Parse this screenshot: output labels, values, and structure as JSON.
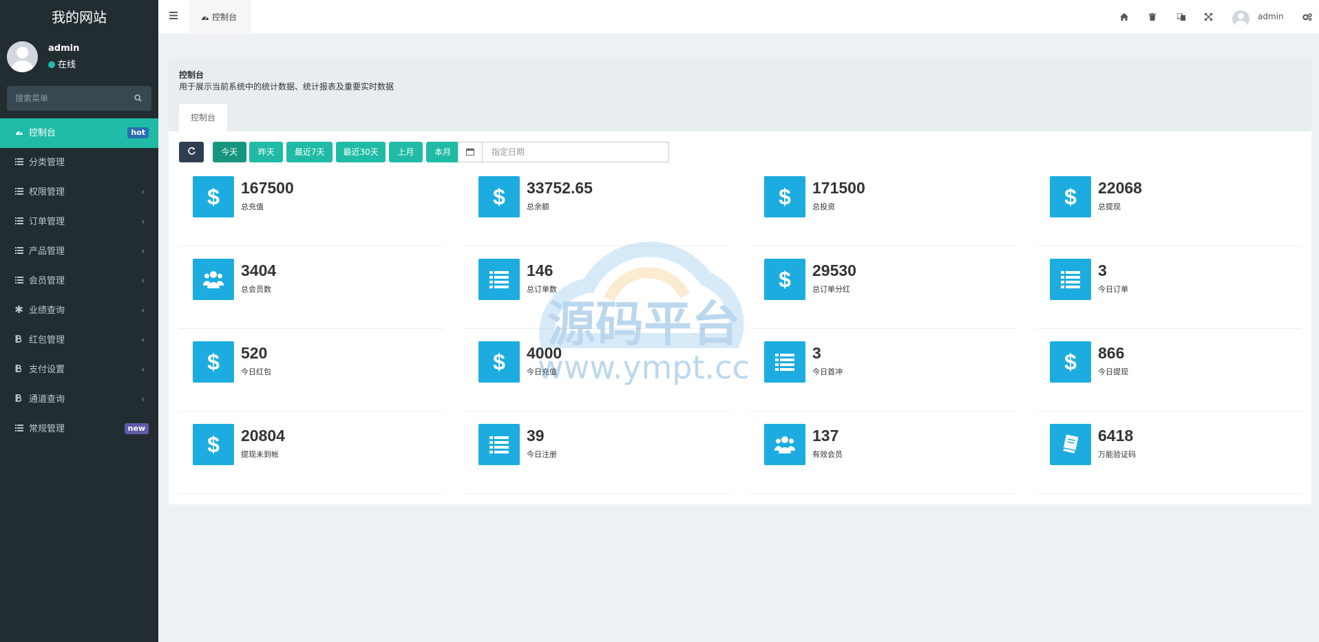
{
  "app": {
    "site_title": "我的网站"
  },
  "user_panel": {
    "name": "admin",
    "status": "在线"
  },
  "search": {
    "placeholder": "搜索菜单"
  },
  "menu": {
    "items": [
      {
        "label": "控制台",
        "icon": "dashboard-icon",
        "badge": "hot",
        "active": true
      },
      {
        "label": "分类管理",
        "icon": "list-icon"
      },
      {
        "label": "权限管理",
        "icon": "list-icon",
        "chevron": "‹"
      },
      {
        "label": "订单管理",
        "icon": "list-icon",
        "chevron": "‹"
      },
      {
        "label": "产品管理",
        "icon": "list-icon",
        "chevron": "‹"
      },
      {
        "label": "会员管理",
        "icon": "list-icon",
        "chevron": "‹"
      },
      {
        "label": "业绩查询",
        "icon": "asterisk-icon",
        "chevron": "‹"
      },
      {
        "label": "红包管理",
        "icon": "bitcoin-icon",
        "chevron": "‹"
      },
      {
        "label": "支付设置",
        "icon": "bitcoin-icon",
        "chevron": "‹"
      },
      {
        "label": "通道查询",
        "icon": "bitcoin-icon",
        "chevron": "‹"
      },
      {
        "label": "常规管理",
        "icon": "list-icon",
        "badge": "new"
      }
    ]
  },
  "topbar": {
    "tab_label": "控制台",
    "user": "admin"
  },
  "panel": {
    "title": "控制台",
    "description": "用于展示当前系统中的统计数据、统计报表及重要实时数据",
    "tab": "控制台"
  },
  "toolbar": {
    "buttons": [
      "今天",
      "昨天",
      "最近7天",
      "最近30天",
      "上月",
      "本月"
    ],
    "selected": "今天",
    "date_placeholder": "指定日期"
  },
  "stats": [
    {
      "value": "167500",
      "label": "总充值",
      "icon": "dollar-icon"
    },
    {
      "value": "33752.65",
      "label": "总余额",
      "icon": "dollar-icon"
    },
    {
      "value": "171500",
      "label": "总投资",
      "icon": "dollar-icon"
    },
    {
      "value": "22068",
      "label": "总提现",
      "icon": "dollar-icon"
    },
    {
      "value": "3404",
      "label": "总会员数",
      "icon": "users-icon"
    },
    {
      "value": "146",
      "label": "总订单数",
      "icon": "list-icon"
    },
    {
      "value": "29530",
      "label": "总订单分红",
      "icon": "dollar-icon"
    },
    {
      "value": "3",
      "label": "今日订单",
      "icon": "list-icon"
    },
    {
      "value": "520",
      "label": "今日红包",
      "icon": "dollar-icon"
    },
    {
      "value": "4000",
      "label": "今日充值",
      "icon": "dollar-icon"
    },
    {
      "value": "3",
      "label": "今日首冲",
      "icon": "list-icon"
    },
    {
      "value": "866",
      "label": "今日提现",
      "icon": "dollar-icon"
    },
    {
      "value": "20804",
      "label": "提现未到帐",
      "icon": "dollar-icon"
    },
    {
      "value": "39",
      "label": "今日注册",
      "icon": "list-icon"
    },
    {
      "value": "137",
      "label": "有效会员",
      "icon": "users-icon"
    },
    {
      "value": "6418",
      "label": "万能验证码",
      "icon": "book-icon"
    }
  ],
  "watermark": {
    "text_cn": "源码平台",
    "text_url": "www.ympt.cc"
  },
  "colors": {
    "sidebar_bg": "#222d32",
    "accent": "#1fbba6",
    "stat_icon_bg": "#1cace0"
  }
}
